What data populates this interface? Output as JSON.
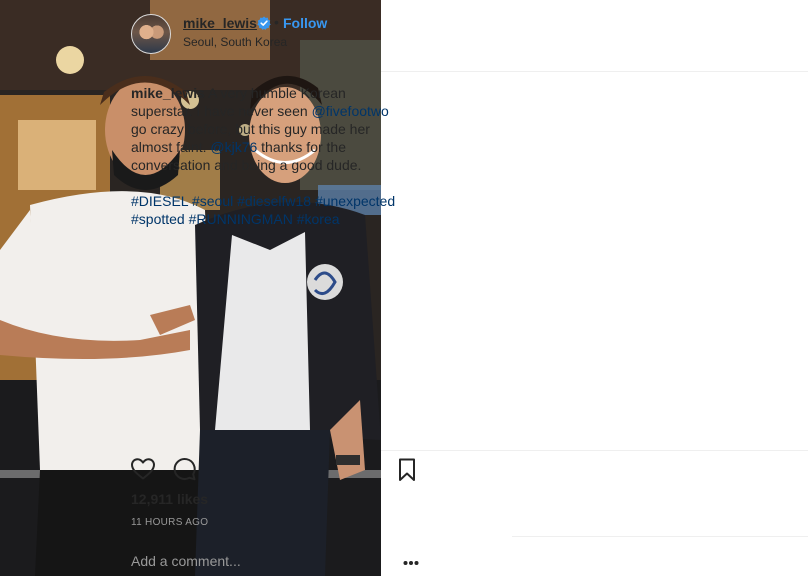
{
  "post": {
    "image_alt": "Two men posing for a photo at night on a street in Seoul"
  },
  "header": {
    "username": "mike_lewis",
    "separator": "•",
    "follow_label": "Follow",
    "location": "Seoul, South Korea"
  },
  "caption": {
    "username": "mike_lewis",
    "text_1": " A very humble Korean superstar. I have never seen ",
    "mention_1": "@fivefootwo",
    "text_2": " go crazy before, but this guy made her almost faint. ",
    "mention_2": "@kjk76",
    "text_3": " thanks for the conversation and being a good dude.",
    "hashtags": [
      "#DIESEL",
      "#seoul",
      "#dieselfw18",
      "#unexpected",
      "#spotted",
      "#RUNNINGMAN",
      "#korea"
    ]
  },
  "actions": {
    "like_icon": "heart-icon",
    "comment_icon": "speech-bubble-icon",
    "save_icon": "bookmark-icon"
  },
  "stats": {
    "likes": "12,911 likes",
    "time_ago": "11 HOURS AGO"
  },
  "comment_box": {
    "placeholder": "Add a comment...",
    "more_icon": "ellipsis-icon"
  },
  "colors": {
    "link": "#003569",
    "follow": "#3897f0",
    "verified": "#3897f0",
    "muted": "#999999"
  }
}
